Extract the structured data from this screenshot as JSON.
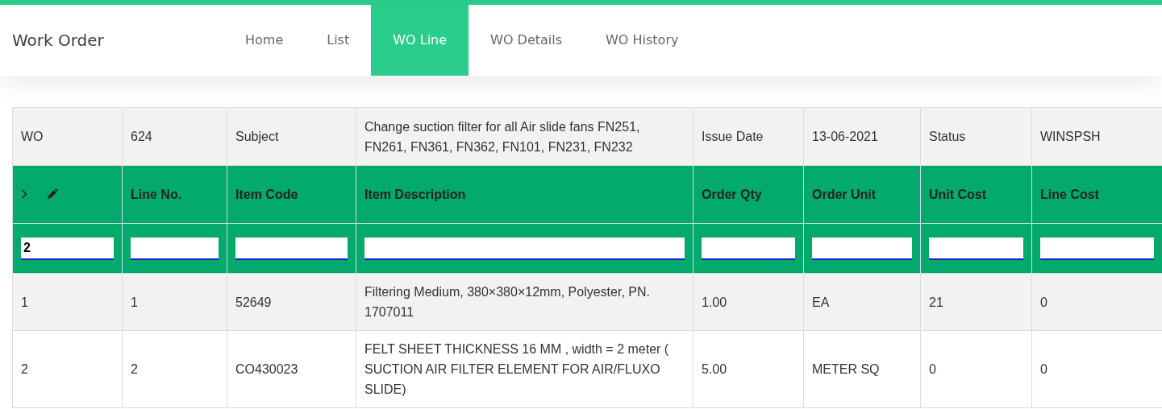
{
  "app": {
    "title": "Work Order"
  },
  "tabs": [
    {
      "label": "Home",
      "selected": false
    },
    {
      "label": "List",
      "selected": false
    },
    {
      "label": "WO Line",
      "selected": true
    },
    {
      "label": "WO Details",
      "selected": false
    },
    {
      "label": "WO History",
      "selected": false
    }
  ],
  "order_info": [
    "WO",
    "624",
    "Subject",
    "Change suction filter for all Air slide fans FN251, FN261, FN361, FN362, FN101, FN231, FN232",
    "Issue Date",
    "13-06-2021",
    "Status",
    "WINSPSH"
  ],
  "table": {
    "columns": [
      {
        "kind": "tools"
      },
      {
        "kind": "text",
        "label": "Line No."
      },
      {
        "kind": "text",
        "label": "Item Code"
      },
      {
        "kind": "text",
        "label": "Item Description"
      },
      {
        "kind": "text",
        "label": "Order Qty"
      },
      {
        "kind": "text",
        "label": "Order Unit"
      },
      {
        "kind": "text",
        "label": "Unit Cost"
      },
      {
        "kind": "text",
        "label": "Line Cost"
      }
    ],
    "filters": [
      {
        "kind": "field",
        "value": "2"
      },
      {
        "kind": "field"
      },
      {
        "kind": "field"
      },
      {
        "kind": "field"
      },
      {
        "kind": "field"
      },
      {
        "kind": "field"
      },
      {
        "kind": "field"
      },
      {
        "kind": "field"
      }
    ],
    "rows": [
      [
        "1",
        "1",
        "52649",
        "Filtering Medium, 380×380×12mm, Polyester, PN. 1707011",
        "1.00",
        "EA",
        "21",
        "0"
      ],
      [
        "2",
        "2",
        "CO430023",
        "FELT SHEET THICKNESS 16 MM , width = 2 meter ( SUCTION AIR FILTER ELEMENT FOR AIR/FLUXO SLIDE)",
        "5.00",
        "METER SQ",
        "0",
        "0"
      ]
    ]
  }
}
